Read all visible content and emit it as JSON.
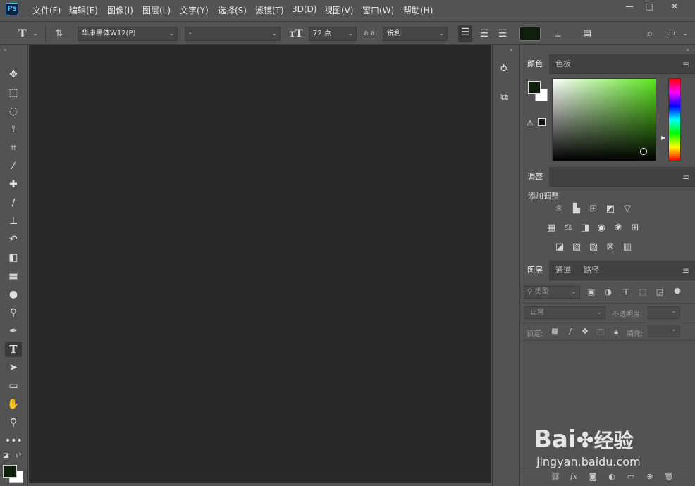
{
  "app": {
    "logo": "Ps"
  },
  "menubar": {
    "items": [
      "文件(F)",
      "编辑(E)",
      "图像(I)",
      "图层(L)",
      "文字(Y)",
      "选择(S)",
      "滤镜(T)",
      "3D(D)",
      "视图(V)",
      "窗口(W)",
      "帮助(H)"
    ],
    "window_buttons": {
      "minimize": "—",
      "restore": "□",
      "close": "✕"
    }
  },
  "options_bar": {
    "tool_glyph": "T",
    "font_family": "华康黑体W12(P)",
    "font_style": "-",
    "font_size": "72 点",
    "antialias_label": "a a",
    "antialias": "锐利",
    "text_color": "#0e1f0c"
  },
  "tools": [
    "move",
    "marquee",
    "lasso",
    "quick-select",
    "crop",
    "eyedropper",
    "healing",
    "brush",
    "stamp",
    "history-brush",
    "eraser",
    "gradient",
    "blur",
    "dodge",
    "pen",
    "type",
    "path-select",
    "rectangle",
    "hand",
    "zoom",
    "more"
  ],
  "colors": {
    "foreground": "#0e1f0c",
    "background": "#ffffff",
    "accent": "#31a8ff"
  },
  "color_panel": {
    "tabs": [
      "颜色",
      "色板"
    ],
    "active": "颜色"
  },
  "adjustments_panel": {
    "tab": "调整",
    "heading": "添加调整"
  },
  "layers_panel": {
    "tabs": [
      "图层",
      "通道",
      "路径"
    ],
    "filter_label": "类型",
    "blend_mode": "正常",
    "opacity_label": "不透明度:",
    "lock_label": "锁定:",
    "fill_label": "填充:"
  },
  "watermark": {
    "brand": "Bai",
    "brand_cn": "经验",
    "url": "jingyan.baidu.com"
  }
}
